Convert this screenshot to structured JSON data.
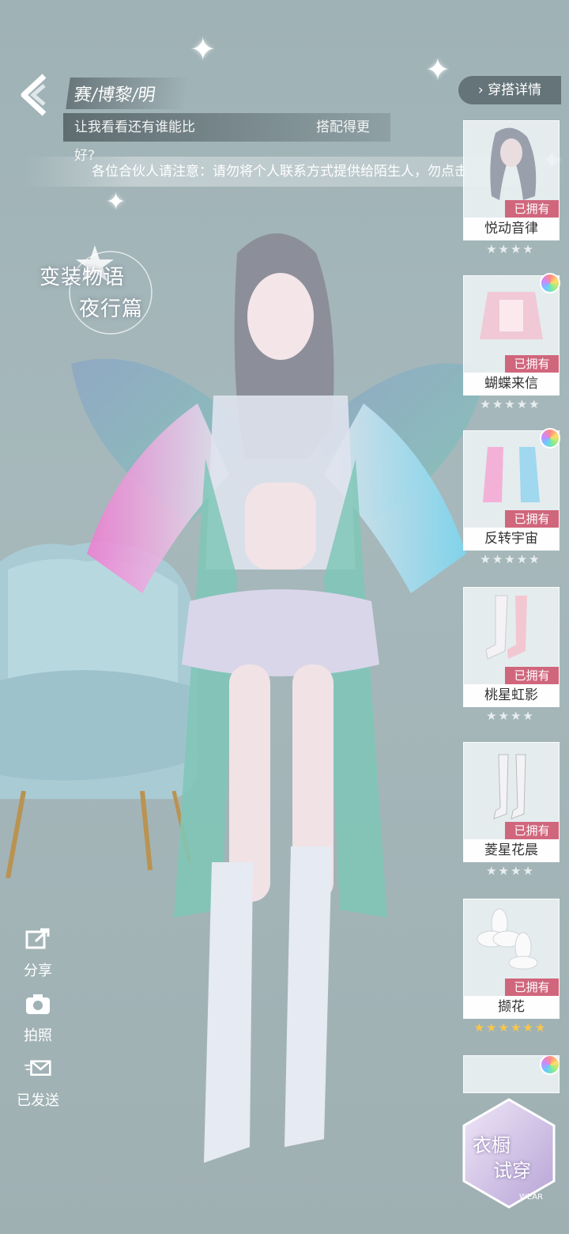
{
  "header": {
    "title": "赛/博黎/明",
    "subtitle": "让我看看还有谁能比　　　　　　　　　搭配得更好?",
    "details_button": "穿搭详情"
  },
  "notice": "各位合伙人请注意：请勿将个人联系方式提供给陌生人，勿点击",
  "logo": {
    "line1": "变装物语",
    "line2": "夜行篇"
  },
  "side_actions": [
    {
      "label": "分享",
      "icon": "share-icon"
    },
    {
      "label": "拍照",
      "icon": "camera-icon"
    },
    {
      "label": "已发送",
      "icon": "mail-sent-icon"
    }
  ],
  "items": [
    {
      "name": "悦动音律",
      "status": "已拥有",
      "stars": "★★★★",
      "tier": "silver"
    },
    {
      "name": "蝴蝶来信",
      "status": "已拥有",
      "stars": "★★★★★",
      "tier": "silver"
    },
    {
      "name": "反转宇宙",
      "status": "已拥有",
      "stars": "★★★★★",
      "tier": "silver"
    },
    {
      "name": "桃星虹影",
      "status": "已拥有",
      "stars": "★★★★",
      "tier": "silver"
    },
    {
      "name": "菱星花晨",
      "status": "已拥有",
      "stars": "★★★★",
      "tier": "silver"
    },
    {
      "name": "撷花",
      "status": "已拥有",
      "stars": "★★★★★★",
      "tier": "gold"
    }
  ],
  "wardrobe_button": {
    "line1": "衣橱",
    "line2": "试穿",
    "badge": "WEAR"
  },
  "colors": {
    "owned_badge": "#d0667c",
    "gold_star": "#f7c64a",
    "background": "#a3b5b8"
  }
}
